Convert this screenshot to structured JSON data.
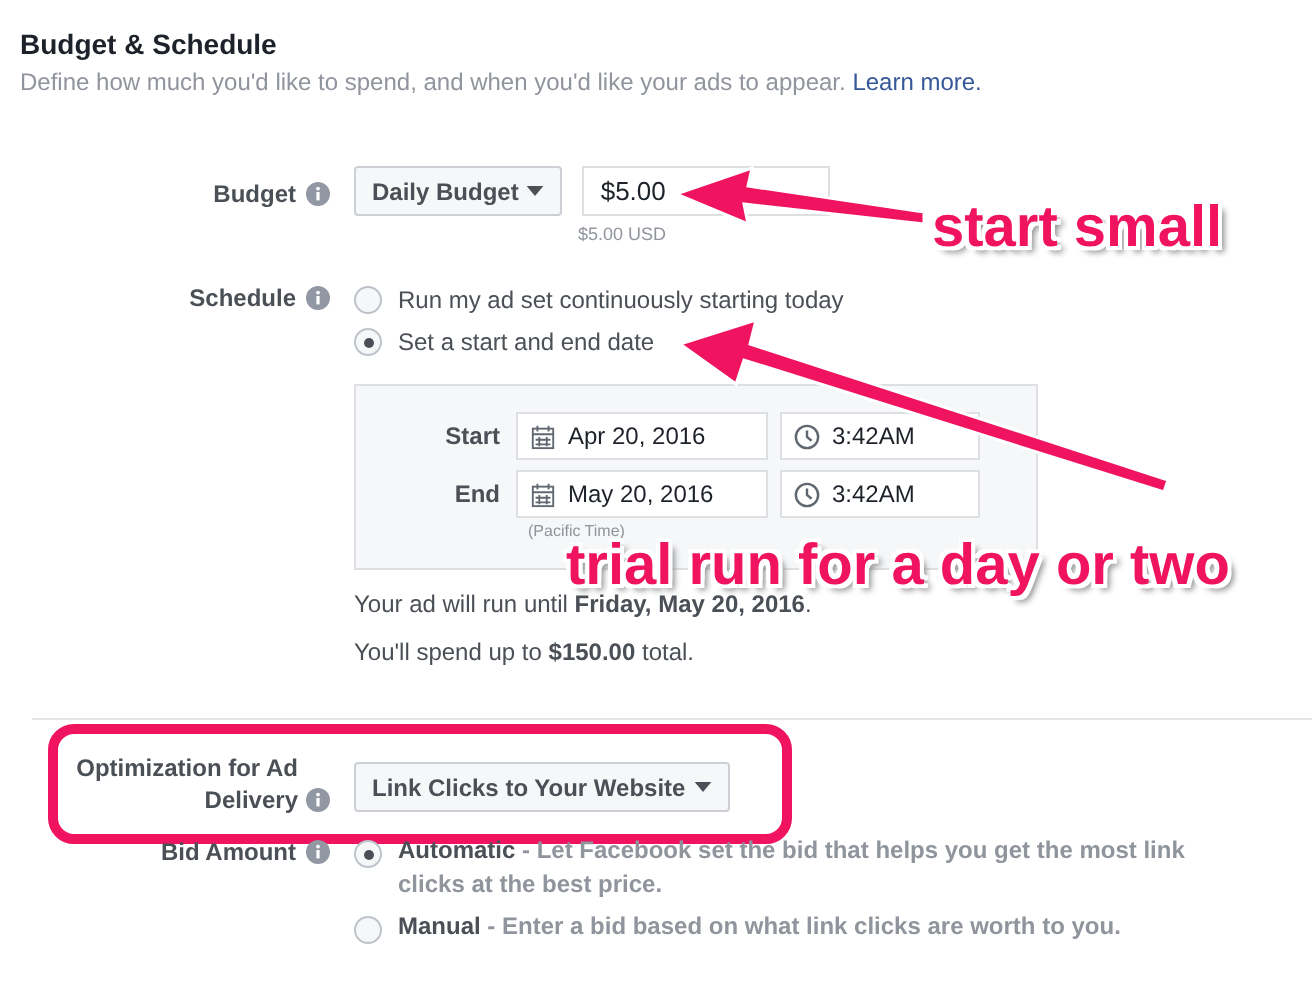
{
  "section": {
    "title": "Budget & Schedule",
    "description": "Define how much you'd like to spend, and when you'd like your ads to appear.",
    "link": "Learn more."
  },
  "budget": {
    "label": "Budget",
    "type": "Daily Budget",
    "amount": "$5.00",
    "note": "$5.00 USD"
  },
  "schedule": {
    "label": "Schedule",
    "options": [
      {
        "label": "Run my ad set continuously starting today",
        "selected": false
      },
      {
        "label": "Set a start and end date",
        "selected": true
      }
    ],
    "rows": [
      {
        "label": "Start",
        "date": "Apr 20, 2016",
        "time": "3:42AM"
      },
      {
        "label": "End",
        "date": "May 20, 2016",
        "time": "3:42AM"
      }
    ],
    "timezone": "(Pacific Time)",
    "summary": [
      "Your ad will run until **Friday, May 20, 2016**.",
      "You'll spend up to **$150.00** total."
    ]
  },
  "optimization": {
    "label": "Optimization for Ad Delivery",
    "value": "Link Clicks to Your Website"
  },
  "bid_amount": {
    "label": "Bid Amount",
    "options": [
      {
        "title": "Automatic",
        "description": " - Let Facebook set the bid that helps you get the most link clicks at the best price.",
        "selected": true
      },
      {
        "title": "Manual",
        "description": " - Enter a bid based on what link clicks are worth to you.",
        "selected": false
      }
    ]
  },
  "annotations": [
    "start small",
    "trial run for a day or two"
  ]
}
